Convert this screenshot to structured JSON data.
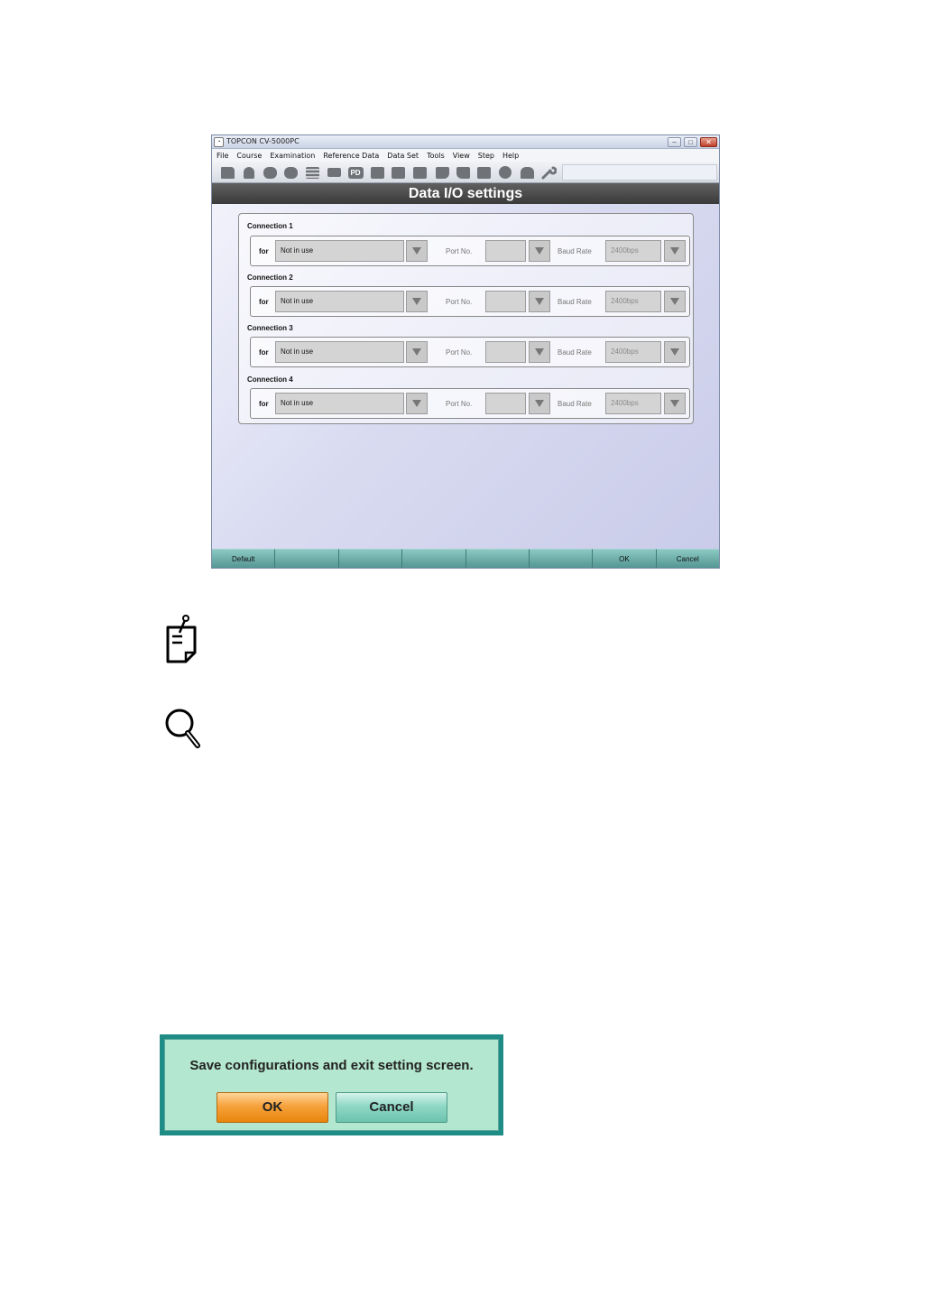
{
  "window": {
    "title": "TOPCON CV-5000PC",
    "controls": {
      "minimize": "–",
      "maximize": "□",
      "close": "✕"
    }
  },
  "menu": [
    "File",
    "Course",
    "Examination",
    "Reference Data",
    "Data Set",
    "Tools",
    "View",
    "Step",
    "Help"
  ],
  "toolbar": {
    "icons": [
      "folder-icon",
      "person-icon",
      "lens-pair-icon",
      "glasses-icon",
      "chart-icon",
      "card-icon",
      "pd-icon",
      "monitor-icon",
      "near-chart-icon",
      "dial-icon",
      "speech-icon",
      "speech-down-icon",
      "book-icon",
      "circle-icon",
      "house-icon",
      "wrench-icon"
    ],
    "pd_label": "PD"
  },
  "header": {
    "title": "Data I/O settings"
  },
  "connections": [
    {
      "title": "Connection 1",
      "for_label": "for",
      "for_value": "Not in use",
      "port_label": "Port No.",
      "port_value": "",
      "baud_label": "Baud Rate",
      "baud_value": "2400bps"
    },
    {
      "title": "Connection 2",
      "for_label": "for",
      "for_value": "Not in use",
      "port_label": "Port No.",
      "port_value": "",
      "baud_label": "Baud Rate",
      "baud_value": "2400bps"
    },
    {
      "title": "Connection 3",
      "for_label": "for",
      "for_value": "Not in use",
      "port_label": "Port No.",
      "port_value": "",
      "baud_label": "Baud Rate",
      "baud_value": "2400bps"
    },
    {
      "title": "Connection 4",
      "for_label": "for",
      "for_value": "Not in use",
      "port_label": "Port No.",
      "port_value": "",
      "baud_label": "Baud Rate",
      "baud_value": "2400bps"
    }
  ],
  "footer": [
    "Default",
    "",
    "",
    "",
    "",
    "",
    "OK",
    "Cancel"
  ],
  "dialog": {
    "message": "Save configurations and exit setting screen.",
    "ok_label": "OK",
    "cancel_label": "Cancel"
  }
}
